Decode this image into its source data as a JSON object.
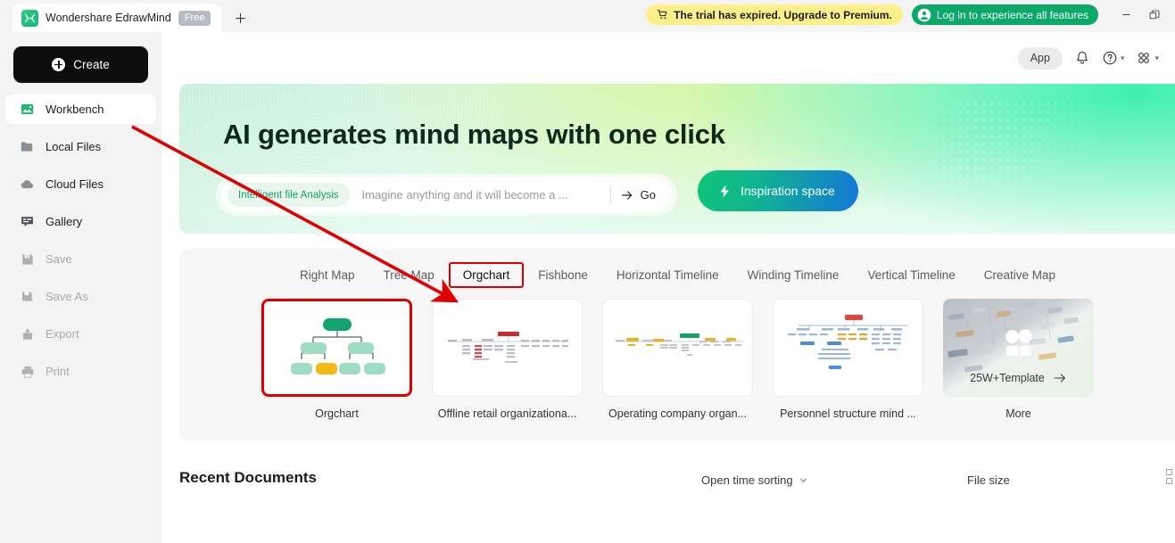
{
  "titlebar": {
    "app_tab_title": "Wondershare EdrawMind",
    "free_badge": "Free",
    "new_tab_icon": "plus-icon",
    "trial_banner": "The trial has expired. Upgrade to Premium.",
    "trial_icon": "cart-icon",
    "login_button": "Log in to experience all features",
    "login_icon": "user-circle-icon",
    "minimize_icon": "minimize-icon",
    "restore_icon": "restore-icon"
  },
  "sidebar": {
    "create_label": "Create",
    "items": [
      {
        "label": "Workbench",
        "icon": "workbench-icon",
        "state": "active"
      },
      {
        "label": "Local Files",
        "icon": "folder-icon",
        "state": "normal"
      },
      {
        "label": "Cloud Files",
        "icon": "cloud-icon",
        "state": "normal"
      },
      {
        "label": "Gallery",
        "icon": "gallery-icon",
        "state": "normal"
      },
      {
        "label": "Save",
        "icon": "save-icon",
        "state": "disabled"
      },
      {
        "label": "Save As",
        "icon": "save-as-icon",
        "state": "disabled"
      },
      {
        "label": "Export",
        "icon": "export-icon",
        "state": "disabled"
      },
      {
        "label": "Print",
        "icon": "print-icon",
        "state": "disabled"
      }
    ]
  },
  "topbar": {
    "app_pill": "App",
    "bell_icon": "bell-icon",
    "help_icon": "help-circle-icon",
    "grid_icon": "grid-apps-icon"
  },
  "hero": {
    "title": "AI generates mind maps with one click",
    "chip": "Intelligent file Analysis",
    "input_placeholder": "Imagine anything and it will become a ...",
    "input_value": "",
    "go_label": "Go",
    "go_icon": "arrow-right-icon",
    "inspiration_label": "Inspiration space",
    "inspiration_icon": "lightning-icon",
    "gradient_from": "#c8f0dd",
    "gradient_to": "#3ef0ae"
  },
  "templates": {
    "tabs": [
      {
        "label": "Right Map",
        "selected": false
      },
      {
        "label": "Tree Map",
        "selected": false
      },
      {
        "label": "Orgchart",
        "selected": true
      },
      {
        "label": "Fishbone",
        "selected": false
      },
      {
        "label": "Horizontal Timeline",
        "selected": false
      },
      {
        "label": "Winding Timeline",
        "selected": false
      },
      {
        "label": "Vertical Timeline",
        "selected": false
      },
      {
        "label": "Creative Map",
        "selected": false
      }
    ],
    "cards": [
      {
        "label": "Orgchart",
        "thumb": "orgchart-diagram",
        "selected": true
      },
      {
        "label": "Offline retail organizationa...",
        "thumb": "offline-retail-diagram",
        "selected": false
      },
      {
        "label": "Operating company organ...",
        "thumb": "operating-company-diagram",
        "selected": false
      },
      {
        "label": "Personnel structure mind ...",
        "thumb": "personnel-structure-diagram",
        "selected": false
      },
      {
        "label": "More",
        "thumb": "more-templates-collage",
        "selected": false,
        "overlay_text": "25W+Template",
        "overlay_icon": "arrow-right-icon"
      }
    ]
  },
  "recent": {
    "title": "Recent Documents",
    "sort_label": "Open time sorting",
    "sort_icon": "chevron-down-icon",
    "filesize_label": "File size",
    "view_toggle_icon": "list-view-icon"
  },
  "annotation": {
    "arrow_color": "#e00000",
    "highlight_color": "#e00000"
  }
}
